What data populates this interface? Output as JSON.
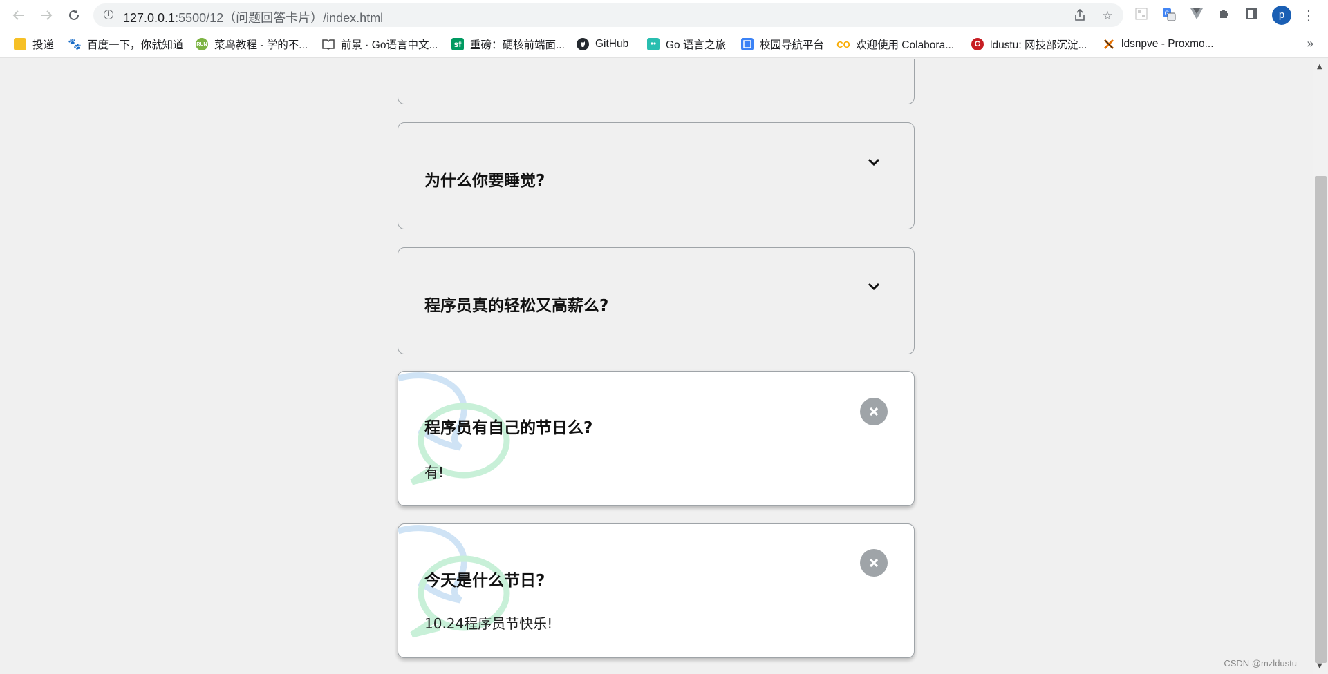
{
  "browser": {
    "url_host": "127.0.0.1",
    "url_rest": ":5500/12（问题回答卡片）/index.html",
    "profile_initial": "p",
    "bookmarks": [
      {
        "label": "投递",
        "icon": "folder-icon",
        "color": "#f6c026"
      },
      {
        "label": "百度一下，你就知道",
        "icon": "baidu-icon",
        "color": "#2932e1"
      },
      {
        "label": "菜鸟教程 - 学的不...",
        "icon": "runoob-icon",
        "color": "#7cb342"
      },
      {
        "label": "前景 · Go语言中文...",
        "icon": "book-icon",
        "color": "#444444"
      },
      {
        "label": "重磅：硬核前端面...",
        "icon": "segmentfault-icon",
        "color": "#009a61"
      },
      {
        "label": "GitHub",
        "icon": "github-icon",
        "color": "#24292f"
      },
      {
        "label": "Go 语言之旅",
        "icon": "gopher-icon",
        "color": "#29beb0"
      },
      {
        "label": "校园导航平台",
        "icon": "campus-icon",
        "color": "#3b82f6"
      },
      {
        "label": "欢迎使用 Colabora...",
        "icon": "colab-icon",
        "color": "#f9ab00"
      },
      {
        "label": "ldustu: 网技部沉淀...",
        "icon": "gitee-icon",
        "color": "#c71d23"
      },
      {
        "label": "ldsnpve - Proxmo...",
        "icon": "proxmox-icon",
        "color": "#e57000"
      }
    ]
  },
  "faqs": [
    {
      "question": "",
      "answer": "",
      "state": "collapsed"
    },
    {
      "question": "为什么你要睡觉?",
      "answer": "",
      "state": "collapsed"
    },
    {
      "question": "程序员真的轻松又高薪么?",
      "answer": "",
      "state": "collapsed"
    },
    {
      "question": "程序员有自己的节日么?",
      "answer": "有!",
      "state": "expanded"
    },
    {
      "question": "今天是什么节日?",
      "answer": "10.24程序员节快乐!",
      "state": "expanded"
    }
  ],
  "watermark": "CSDN @mzldustu",
  "colors": {
    "page_bg": "#f0f0f0",
    "card_border": "#9fa4a8",
    "bubble_blue": "#cfe3f5",
    "bubble_green": "#c8f0d8"
  }
}
